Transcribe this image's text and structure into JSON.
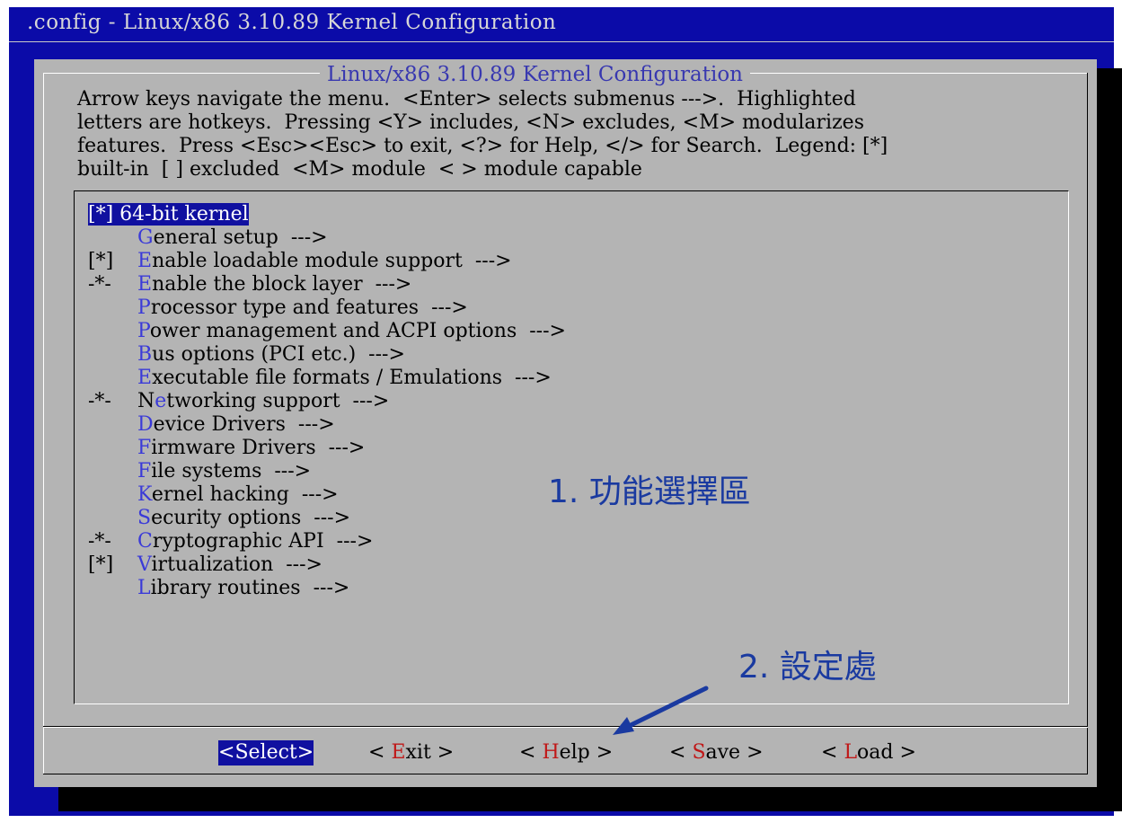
{
  "window": {
    "title": ".config - Linux/x86 3.10.89 Kernel Configuration"
  },
  "dialog": {
    "title": "Linux/x86 3.10.89 Kernel Configuration",
    "help_lines": [
      "Arrow keys navigate the menu.  <Enter> selects submenus --->.  Highlighted",
      "letters are hotkeys.  Pressing <Y> includes, <N> excludes, <M> modularizes",
      "features.  Press <Esc><Esc> to exit, <?> for Help, </> for Search.  Legend: [*]",
      "built-in  [ ] excluded  <M> module  < > module capable"
    ]
  },
  "menu": {
    "items": [
      {
        "prefix": "[*]",
        "hot": "6",
        "rest": "4-bit kernel",
        "selected": true
      },
      {
        "prefix": "",
        "hot": "G",
        "rest": "eneral setup  --->"
      },
      {
        "prefix": "[*]",
        "hot": "E",
        "rest": "nable loadable module support  --->"
      },
      {
        "prefix": "-*-",
        "hot": "E",
        "rest": "nable the block layer  --->"
      },
      {
        "prefix": "",
        "hot": "P",
        "rest": "rocessor type and features  --->"
      },
      {
        "prefix": "",
        "hot": "P",
        "rest": "ower management and ACPI options  --->"
      },
      {
        "prefix": "",
        "hot": "B",
        "rest": "us options (PCI etc.)  --->"
      },
      {
        "prefix": "",
        "hot": "E",
        "rest": "xecutable file formats / Emulations  --->"
      },
      {
        "prefix": "-*-",
        "hot": "N",
        "hotpos": 1,
        "rest": "tworking support  --->",
        "before": "N",
        "hotchar": "e"
      },
      {
        "prefix": "",
        "hot": "D",
        "rest": "evice Drivers  --->"
      },
      {
        "prefix": "",
        "hot": "F",
        "rest": "irmware Drivers  --->"
      },
      {
        "prefix": "",
        "hot": "F",
        "rest": "ile systems  --->"
      },
      {
        "prefix": "",
        "hot": "K",
        "rest": "ernel hacking  --->"
      },
      {
        "prefix": "",
        "hot": "S",
        "rest": "ecurity options  --->"
      },
      {
        "prefix": "-*-",
        "hot": "C",
        "rest": "ryptographic API  --->"
      },
      {
        "prefix": "[*]",
        "hot": "V",
        "rest": "irtualization  --->"
      },
      {
        "prefix": "",
        "hot": "L",
        "rest": "ibrary routines  --->"
      }
    ]
  },
  "buttons": [
    {
      "pre": "<",
      "hk": "S",
      "post": "elect>",
      "active": true
    },
    {
      "pre": "< ",
      "hk": "E",
      "post": "xit >",
      "active": false
    },
    {
      "pre": "< ",
      "hk": "H",
      "post": "elp >",
      "active": false
    },
    {
      "pre": "< ",
      "hk": "S",
      "post": "ave >",
      "active": false
    },
    {
      "pre": "< ",
      "hk": "L",
      "post": "oad >",
      "active": false
    }
  ],
  "annotations": {
    "area1": "1. 功能選擇區",
    "area2": "2. 設定處"
  },
  "colors": {
    "terminal_bg": "#0b0ba8",
    "dialog_bg": "#b4b4b4",
    "highlight_bg": "#1010a0",
    "hotkey_menu": "#3a3ad8",
    "hotkey_button": "#c01818",
    "annotation": "#1a3aa0"
  }
}
